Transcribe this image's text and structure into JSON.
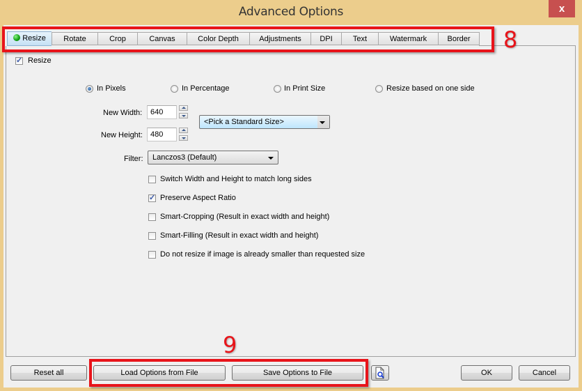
{
  "window": {
    "title": "Advanced Options",
    "close_label": "x"
  },
  "tabs": [
    {
      "label": "Resize",
      "active": true,
      "status_color": "#14a515"
    },
    {
      "label": "Rotate"
    },
    {
      "label": "Crop"
    },
    {
      "label": "Canvas"
    },
    {
      "label": "Color Depth"
    },
    {
      "label": "Adjustments"
    },
    {
      "label": "DPI"
    },
    {
      "label": "Text"
    },
    {
      "label": "Watermark"
    },
    {
      "label": "Border"
    }
  ],
  "annotations": {
    "tabs_number": "8",
    "buttons_number": "9",
    "color": "#e8141a"
  },
  "resize": {
    "enable_label": "Resize",
    "enabled": true,
    "modes": [
      {
        "label": "In Pixels",
        "selected": true
      },
      {
        "label": "In Percentage",
        "selected": false
      },
      {
        "label": "In Print Size",
        "selected": false
      },
      {
        "label": "Resize based on one side",
        "selected": false
      }
    ],
    "width_label": "New Width:",
    "width_value": "640",
    "height_label": "New Height:",
    "height_value": "480",
    "standard_size": "<Pick a Standard Size>",
    "filter_label": "Filter:",
    "filter_value": "Lanczos3 (Default)",
    "options": [
      {
        "label": "Switch Width and Height to match long sides",
        "checked": false
      },
      {
        "label": "Preserve Aspect Ratio",
        "checked": true
      },
      {
        "label": "Smart-Cropping (Result in exact width and height)",
        "checked": false
      },
      {
        "label": "Smart-Filling (Result in exact width and height)",
        "checked": false
      },
      {
        "label": "Do not resize if image is already smaller than requested size",
        "checked": false
      }
    ]
  },
  "footer": {
    "reset_label": "Reset all",
    "load_label": "Load Options from File",
    "save_label": "Save Options to File",
    "preview_icon": "document-preview-icon",
    "ok_label": "OK",
    "cancel_label": "Cancel"
  }
}
